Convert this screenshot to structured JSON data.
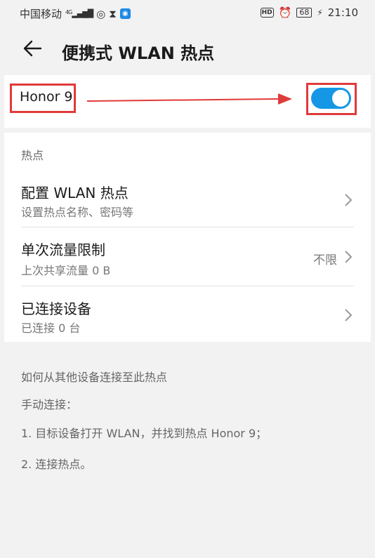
{
  "status_bar": {
    "carrier": "中国移动",
    "network": "4G",
    "hd": "HD",
    "battery": "68",
    "time": "21:10",
    "icons": [
      "signal-icon",
      "hotspot-icon",
      "hourglass-icon",
      "shield-app-icon",
      "hd-icon",
      "alarm-icon",
      "battery-icon",
      "charging-icon"
    ]
  },
  "header": {
    "title": "便携式 WLAN 热点",
    "back_icon": "back-arrow-icon"
  },
  "hotspot": {
    "name": "Honor 9",
    "enabled": true,
    "accent": "#1597e5",
    "highlight": "#e03a3a"
  },
  "settings": {
    "section_label": "热点",
    "rows": [
      {
        "title": "配置 WLAN 热点",
        "subtitle": "设置热点名称、密码等",
        "value": ""
      },
      {
        "title": "单次流量限制",
        "subtitle": "上次共享流量 0 B",
        "value": "不限"
      },
      {
        "title": "已连接设备",
        "subtitle": "已连接 0 台",
        "value": ""
      }
    ]
  },
  "help": {
    "title": "如何从其他设备连接至此热点",
    "manual": "手动连接：",
    "step1": "1. 目标设备打开 WLAN，并找到热点 Honor 9；",
    "step2": "2. 连接热点。"
  }
}
